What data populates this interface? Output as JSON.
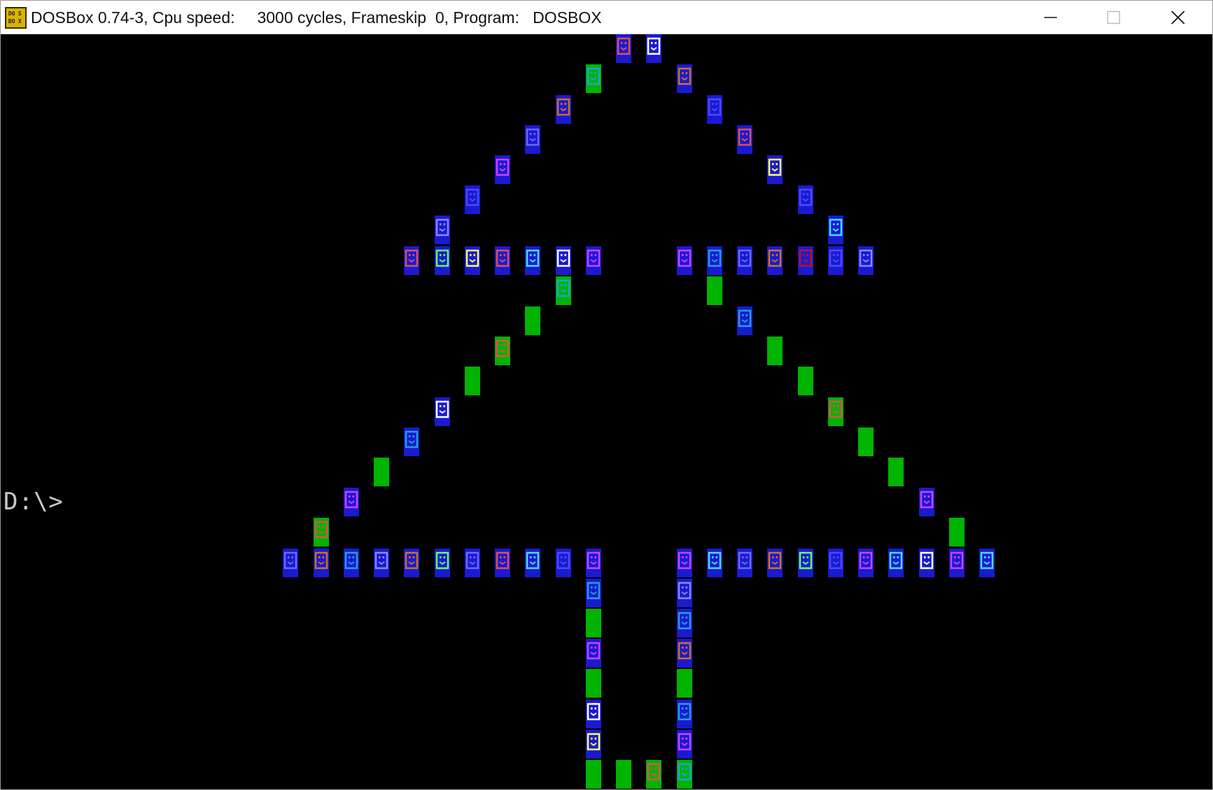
{
  "window": {
    "title": "DOSBox 0.74-3, Cpu speed:     3000 cycles, Frameskip  0, Program:   DOSBOX",
    "icon": "dosbox-icon",
    "icon_text": [
      "DO",
      "S",
      "BO",
      "X"
    ],
    "controls": {
      "minimize": "minimize-icon",
      "maximize": "maximize-icon",
      "close": "close-icon"
    }
  },
  "screen": {
    "prompt": "D:\\>",
    "background": "#000000",
    "prompt_color": "#c8c8c8"
  },
  "palette": {
    "blue": "#1a1ad0",
    "green": "#00b400",
    "red": "#e05050",
    "white": "#ffffff",
    "cyan": "#40e0ff",
    "lightblue": "#4a4aff",
    "magenta": "#d040ff",
    "yellow": "#ffff60",
    "orange": "#d07020",
    "purple": "#6a6aff",
    "lightgreen": "#60ff60",
    "steel": "#8888ff",
    "crimson": "#c01020",
    "teal": "#20a0e0"
  },
  "tree_cells": [
    {
      "c": 20,
      "r": 1,
      "bg": "blue",
      "fg": "red",
      "k": "face"
    },
    {
      "c": 21,
      "r": 1,
      "bg": "blue",
      "fg": "white",
      "k": "face"
    },
    {
      "c": 19,
      "r": 2,
      "bg": "green",
      "fg": "teal",
      "k": "face"
    },
    {
      "c": 22,
      "r": 2,
      "bg": "blue",
      "fg": "orange",
      "k": "face"
    },
    {
      "c": 18,
      "r": 3,
      "bg": "blue",
      "fg": "orange",
      "k": "face"
    },
    {
      "c": 23,
      "r": 3,
      "bg": "blue",
      "fg": "lightblue",
      "k": "face"
    },
    {
      "c": 17,
      "r": 4,
      "bg": "blue",
      "fg": "purple",
      "k": "face"
    },
    {
      "c": 24,
      "r": 4,
      "bg": "blue",
      "fg": "red",
      "k": "face"
    },
    {
      "c": 16,
      "r": 5,
      "bg": "blue",
      "fg": "magenta",
      "k": "face"
    },
    {
      "c": 25,
      "r": 5,
      "bg": "blue",
      "fg": "yellow",
      "k": "face"
    },
    {
      "c": 15,
      "r": 6,
      "bg": "blue",
      "fg": "lightblue",
      "k": "face"
    },
    {
      "c": 26,
      "r": 6,
      "bg": "blue",
      "fg": "lightblue",
      "k": "face"
    },
    {
      "c": 14,
      "r": 7,
      "bg": "blue",
      "fg": "steel",
      "k": "face"
    },
    {
      "c": 27,
      "r": 7,
      "bg": "blue",
      "fg": "cyan",
      "k": "face"
    },
    {
      "c": 13,
      "r": 8,
      "bg": "blue",
      "fg": "red",
      "k": "face"
    },
    {
      "c": 14,
      "r": 8,
      "bg": "blue",
      "fg": "lightgreen",
      "k": "face"
    },
    {
      "c": 15,
      "r": 8,
      "bg": "blue",
      "fg": "yellow",
      "k": "face"
    },
    {
      "c": 16,
      "r": 8,
      "bg": "blue",
      "fg": "red",
      "k": "face"
    },
    {
      "c": 17,
      "r": 8,
      "bg": "blue",
      "fg": "cyan",
      "k": "face"
    },
    {
      "c": 18,
      "r": 8,
      "bg": "blue",
      "fg": "white",
      "k": "face"
    },
    {
      "c": 19,
      "r": 8,
      "bg": "blue",
      "fg": "magenta",
      "k": "face"
    },
    {
      "c": 22,
      "r": 8,
      "bg": "blue",
      "fg": "magenta",
      "k": "face"
    },
    {
      "c": 23,
      "r": 8,
      "bg": "blue",
      "fg": "teal",
      "k": "face"
    },
    {
      "c": 24,
      "r": 8,
      "bg": "blue",
      "fg": "purple",
      "k": "face"
    },
    {
      "c": 25,
      "r": 8,
      "bg": "blue",
      "fg": "orange",
      "k": "face"
    },
    {
      "c": 26,
      "r": 8,
      "bg": "blue",
      "fg": "crimson",
      "k": "face"
    },
    {
      "c": 27,
      "r": 8,
      "bg": "blue",
      "fg": "lightblue",
      "k": "face"
    },
    {
      "c": 28,
      "r": 8,
      "bg": "blue",
      "fg": "steel",
      "k": "face"
    },
    {
      "c": 18,
      "r": 9,
      "bg": "green",
      "fg": "teal",
      "k": "face"
    },
    {
      "c": 23,
      "r": 9,
      "bg": "green",
      "fg": "green",
      "k": "block"
    },
    {
      "c": 17,
      "r": 10,
      "bg": "green",
      "fg": "green",
      "k": "face"
    },
    {
      "c": 24,
      "r": 10,
      "bg": "blue",
      "fg": "teal",
      "k": "face"
    },
    {
      "c": 16,
      "r": 11,
      "bg": "green",
      "fg": "red",
      "k": "face"
    },
    {
      "c": 25,
      "r": 11,
      "bg": "green",
      "fg": "green",
      "k": "face"
    },
    {
      "c": 15,
      "r": 12,
      "bg": "green",
      "fg": "green",
      "k": "block"
    },
    {
      "c": 26,
      "r": 12,
      "bg": "green",
      "fg": "green",
      "k": "block"
    },
    {
      "c": 14,
      "r": 13,
      "bg": "blue",
      "fg": "white",
      "k": "face"
    },
    {
      "c": 27,
      "r": 13,
      "bg": "green",
      "fg": "red",
      "k": "face"
    },
    {
      "c": 13,
      "r": 14,
      "bg": "blue",
      "fg": "teal",
      "k": "face"
    },
    {
      "c": 28,
      "r": 14,
      "bg": "green",
      "fg": "green",
      "k": "face"
    },
    {
      "c": 12,
      "r": 15,
      "bg": "green",
      "fg": "green",
      "k": "block"
    },
    {
      "c": 29,
      "r": 15,
      "bg": "green",
      "fg": "green",
      "k": "block"
    },
    {
      "c": 11,
      "r": 16,
      "bg": "blue",
      "fg": "magenta",
      "k": "face"
    },
    {
      "c": 30,
      "r": 16,
      "bg": "blue",
      "fg": "magenta",
      "k": "face"
    },
    {
      "c": 10,
      "r": 17,
      "bg": "green",
      "fg": "red",
      "k": "face"
    },
    {
      "c": 31,
      "r": 17,
      "bg": "green",
      "fg": "green",
      "k": "face"
    },
    {
      "c": 9,
      "r": 18,
      "bg": "blue",
      "fg": "purple",
      "k": "face"
    },
    {
      "c": 10,
      "r": 18,
      "bg": "blue",
      "fg": "orange",
      "k": "face"
    },
    {
      "c": 11,
      "r": 18,
      "bg": "blue",
      "fg": "teal",
      "k": "face"
    },
    {
      "c": 12,
      "r": 18,
      "bg": "blue",
      "fg": "steel",
      "k": "face"
    },
    {
      "c": 13,
      "r": 18,
      "bg": "blue",
      "fg": "orange",
      "k": "face"
    },
    {
      "c": 14,
      "r": 18,
      "bg": "blue",
      "fg": "lightgreen",
      "k": "face"
    },
    {
      "c": 15,
      "r": 18,
      "bg": "blue",
      "fg": "purple",
      "k": "face"
    },
    {
      "c": 16,
      "r": 18,
      "bg": "blue",
      "fg": "red",
      "k": "face"
    },
    {
      "c": 17,
      "r": 18,
      "bg": "blue",
      "fg": "cyan",
      "k": "face"
    },
    {
      "c": 18,
      "r": 18,
      "bg": "blue",
      "fg": "lightblue",
      "k": "face"
    },
    {
      "c": 19,
      "r": 18,
      "bg": "blue",
      "fg": "magenta",
      "k": "face"
    },
    {
      "c": 22,
      "r": 18,
      "bg": "blue",
      "fg": "magenta",
      "k": "face"
    },
    {
      "c": 23,
      "r": 18,
      "bg": "blue",
      "fg": "cyan",
      "k": "face"
    },
    {
      "c": 24,
      "r": 18,
      "bg": "blue",
      "fg": "purple",
      "k": "face"
    },
    {
      "c": 25,
      "r": 18,
      "bg": "blue",
      "fg": "orange",
      "k": "face"
    },
    {
      "c": 26,
      "r": 18,
      "bg": "blue",
      "fg": "lightgreen",
      "k": "face"
    },
    {
      "c": 27,
      "r": 18,
      "bg": "blue",
      "fg": "lightblue",
      "k": "face"
    },
    {
      "c": 28,
      "r": 18,
      "bg": "blue",
      "fg": "magenta",
      "k": "face"
    },
    {
      "c": 29,
      "r": 18,
      "bg": "blue",
      "fg": "cyan",
      "k": "face"
    },
    {
      "c": 30,
      "r": 18,
      "bg": "blue",
      "fg": "white",
      "k": "face"
    },
    {
      "c": 31,
      "r": 18,
      "bg": "blue",
      "fg": "magenta",
      "k": "face"
    },
    {
      "c": 32,
      "r": 18,
      "bg": "blue",
      "fg": "cyan",
      "k": "face"
    },
    {
      "c": 19,
      "r": 19,
      "bg": "blue",
      "fg": "teal",
      "k": "face"
    },
    {
      "c": 22,
      "r": 19,
      "bg": "blue",
      "fg": "steel",
      "k": "face"
    },
    {
      "c": 19,
      "r": 20,
      "bg": "green",
      "fg": "green",
      "k": "face"
    },
    {
      "c": 22,
      "r": 20,
      "bg": "blue",
      "fg": "teal",
      "k": "face"
    },
    {
      "c": 19,
      "r": 21,
      "bg": "blue",
      "fg": "magenta",
      "k": "face"
    },
    {
      "c": 22,
      "r": 21,
      "bg": "blue",
      "fg": "orange",
      "k": "face"
    },
    {
      "c": 19,
      "r": 22,
      "bg": "green",
      "fg": "green",
      "k": "block"
    },
    {
      "c": 22,
      "r": 22,
      "bg": "green",
      "fg": "green",
      "k": "block"
    },
    {
      "c": 19,
      "r": 23,
      "bg": "blue",
      "fg": "white",
      "k": "face"
    },
    {
      "c": 22,
      "r": 23,
      "bg": "blue",
      "fg": "teal",
      "k": "face"
    },
    {
      "c": 19,
      "r": 24,
      "bg": "blue",
      "fg": "yellow",
      "k": "face"
    },
    {
      "c": 22,
      "r": 24,
      "bg": "blue",
      "fg": "magenta",
      "k": "face"
    },
    {
      "c": 19,
      "r": 25,
      "bg": "green",
      "fg": "green",
      "k": "block"
    },
    {
      "c": 20,
      "r": 25,
      "bg": "green",
      "fg": "green",
      "k": "face"
    },
    {
      "c": 21,
      "r": 25,
      "bg": "green",
      "fg": "red",
      "k": "face"
    },
    {
      "c": 22,
      "r": 25,
      "bg": "green",
      "fg": "teal",
      "k": "face"
    }
  ]
}
